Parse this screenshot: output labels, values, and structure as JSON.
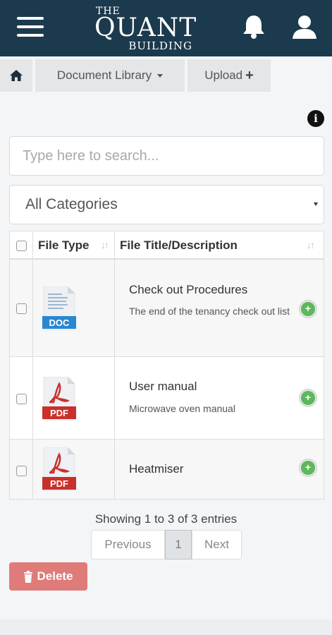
{
  "header": {
    "logo_line1": "THE",
    "logo_line2": "QUANT",
    "logo_line3": "BUILDING"
  },
  "nav": {
    "document_library": "Document Library",
    "upload": "Upload"
  },
  "search": {
    "placeholder": "Type here to search..."
  },
  "category": {
    "selected": "All Categories"
  },
  "table": {
    "headers": {
      "file_type": "File Type",
      "title": "File Title/Description"
    },
    "rows": [
      {
        "type": "DOC",
        "title": "Check out Procedures",
        "description": "The end of the tenancy check out list"
      },
      {
        "type": "PDF",
        "title": "User manual",
        "description": "Microwave oven manual"
      },
      {
        "type": "PDF",
        "title": "Heatmiser",
        "description": ""
      }
    ]
  },
  "pagination": {
    "info": "Showing 1 to 3 of 3 entries",
    "previous": "Previous",
    "current": "1",
    "next": "Next"
  },
  "actions": {
    "delete": "Delete",
    "add_symbol": "+"
  },
  "colors": {
    "header_bg": "#1c3a4e",
    "doc_blue": "#2a87d0",
    "pdf_red": "#c9302c",
    "add_green": "#5cb85c",
    "delete_red": "#d9534f"
  }
}
